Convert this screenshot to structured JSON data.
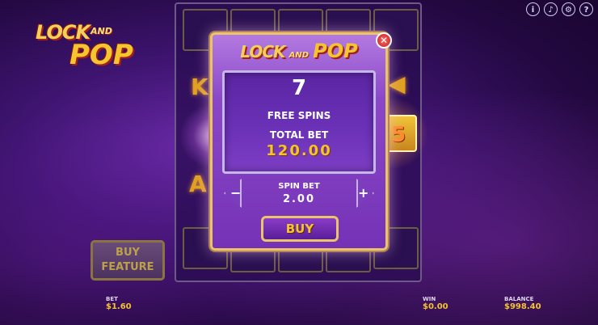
{
  "top_icons": [
    {
      "name": "info-icon",
      "glyph": "i"
    },
    {
      "name": "sound-icon",
      "glyph": "♪"
    },
    {
      "name": "settings-icon",
      "glyph": "⚙"
    },
    {
      "name": "help-icon",
      "glyph": "?"
    }
  ],
  "logo": {
    "lock": "LOCK",
    "and": "AND",
    "pop": "POP"
  },
  "modal": {
    "title_lock": "LOCK",
    "title_and": "AND",
    "title_pop": "POP",
    "close_glyph": "✕",
    "spins_count": "7",
    "spins_label": "FREE SPINS",
    "total_bet_label": "TOTAL BET",
    "total_bet_value": "120.00",
    "spin_bet_label": "SPIN BET",
    "spin_bet_value": "2.00",
    "minus_glyph": "−",
    "plus_glyph": "+",
    "buy_label": "BUY"
  },
  "reel_number_tile": "5",
  "buy_feature": {
    "line1": "BUY",
    "line2": "FEATURE"
  },
  "footer": {
    "bet_label": "BET",
    "bet_value": "$1.60",
    "win_label": "WIN",
    "win_value": "$0.00",
    "balance_label": "BALANCE",
    "balance_value": "$998.40"
  },
  "colors": {
    "accent_gold": "#f5c230",
    "modal_purple": "#7532b6",
    "border_gold": "#e9c46a"
  }
}
